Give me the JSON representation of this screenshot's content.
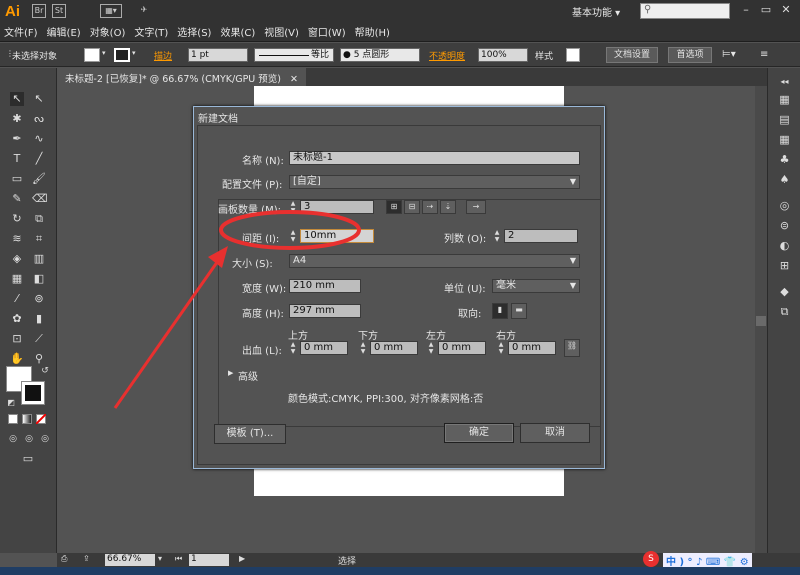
{
  "app": {
    "logo": "Ai",
    "workspace": "基本功能 ▾"
  },
  "menu": [
    "文件(F)",
    "编辑(E)",
    "对象(O)",
    "文字(T)",
    "选择(S)",
    "效果(C)",
    "视图(V)",
    "窗口(W)",
    "帮助(H)"
  ],
  "control_bar": {
    "selection": "未选择对象",
    "stroke_label": "描边",
    "stroke_value": "1 pt",
    "profile": "等比",
    "brush": "● 5 点圆形",
    "opacity_label": "不透明度",
    "opacity_value": "100%",
    "style_label": "样式",
    "doc_setup": "文档设置",
    "prefs": "首选项"
  },
  "tab": {
    "title": "未标题-2 [已恢复]* @ 66.67% (CMYK/GPU 预览)"
  },
  "dialog": {
    "title": "新建文档",
    "name_label": "名称 (N):",
    "name_value": "未标题-1",
    "profile_label": "配置文件 (P):",
    "profile_value": "[自定]",
    "artboards_label": "画板数量 (M):",
    "artboards_value": "3",
    "spacing_label": "间距 (I):",
    "spacing_value": "10mm",
    "columns_label": "列数 (O):",
    "columns_value": "2",
    "size_label": "大小 (S):",
    "size_value": "A4",
    "width_label": "宽度 (W):",
    "width_value": "210 mm",
    "units_label": "单位 (U):",
    "units_value": "毫米",
    "height_label": "高度 (H):",
    "height_value": "297 mm",
    "orientation_label": "取向:",
    "bleed_label": "出血 (L):",
    "bleed_top_label": "上方",
    "bleed_bottom_label": "下方",
    "bleed_left_label": "左方",
    "bleed_right_label": "右方",
    "bleed_top": "0 mm",
    "bleed_bottom": "0 mm",
    "bleed_left": "0 mm",
    "bleed_right": "0 mm",
    "advanced_label": "高级",
    "summary": "颜色模式:CMYK, PPI:300, 对齐像素网格:否",
    "templates_button": "模板 (T)...",
    "ok_button": "确定",
    "cancel_button": "取消"
  },
  "status": {
    "zoom": "66.67%",
    "page": "1",
    "mode": "选择"
  },
  "colors": {
    "annotation": "#e8302f",
    "accent": "#ff9a00"
  }
}
